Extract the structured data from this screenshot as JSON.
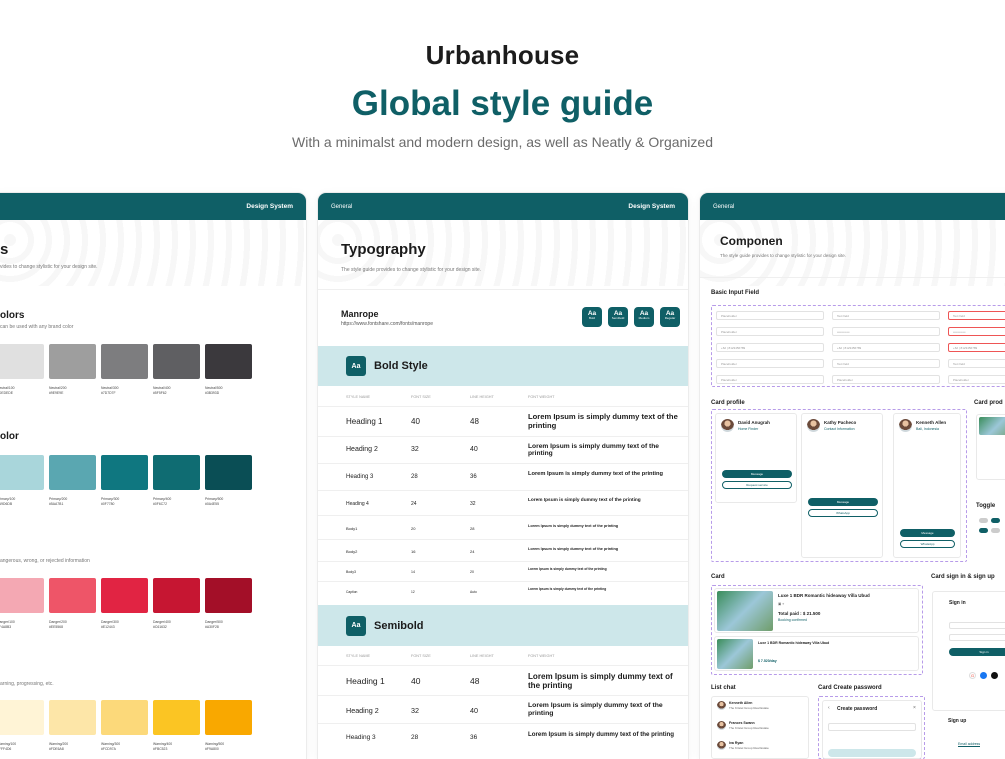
{
  "hero": {
    "brand": "Urbanhouse",
    "title": "Global style guide",
    "subtitle": "With a minimalst and modern design, as well as Neatly & Organized"
  },
  "colors": {
    "primary": "#0f5f66",
    "band": "#cde7ea"
  },
  "left_panel": {
    "bar_right": "Design System",
    "page_title": "s",
    "page_sub": "vides to change stylistic for your design site.",
    "neutral": {
      "title": "olors",
      "sub": "can be used with any brand color",
      "swatches": [
        {
          "color": "#e0e0e0",
          "name": "Neutral/100",
          "hex": "#DEDEDE"
        },
        {
          "color": "#9e9e9e",
          "name": "Neutral/200",
          "hex": "#9E9E9E"
        },
        {
          "color": "#7d7d7f",
          "name": "Neutral/300",
          "hex": "#7D7D7F"
        },
        {
          "color": "#5f5f62",
          "name": "Neutral/400",
          "hex": "#5F5F62"
        },
        {
          "color": "#3b393d",
          "name": "Neutral/500",
          "hex": "#3B393D"
        }
      ]
    },
    "primary": {
      "title": "olor",
      "swatches": [
        {
          "color": "#a9d6db",
          "name": "Primary/100",
          "hex": "#A9D6DB"
        },
        {
          "color": "#5aa7b1",
          "name": "Primary/200",
          "hex": "#5AA7B1"
        },
        {
          "color": "#0f7780",
          "name": "Primary/300",
          "hex": "#0F7780"
        },
        {
          "color": "#0f6c72",
          "name": "Primary/400",
          "hex": "#0F6C72"
        },
        {
          "color": "#0a4e55",
          "name": "Primary/500",
          "hex": "#0A4E55"
        }
      ]
    },
    "danger": {
      "sub": "angerous, wrong, or rejected information",
      "swatches": [
        {
          "color": "#f4a8b3",
          "name": "Danger/100",
          "hex": "#F4A8B3"
        },
        {
          "color": "#ee5568",
          "name": "Danger/200",
          "hex": "#EE5568"
        },
        {
          "color": "#e12443",
          "name": "Danger/300",
          "hex": "#E12443"
        },
        {
          "color": "#c61632",
          "name": "Danger/400",
          "hex": "#C61632"
        },
        {
          "color": "#a30f28",
          "name": "Danger/500",
          "hex": "#A30F28"
        }
      ]
    },
    "warning": {
      "sub": "arning, progressing, etc.",
      "swatches": [
        {
          "color": "#fff4d6",
          "name": "Warning/100",
          "hex": "#FFF4D6"
        },
        {
          "color": "#fde6a8",
          "name": "Warning/200",
          "hex": "#FDE6A8"
        },
        {
          "color": "#fcd97a",
          "name": "Warning/300",
          "hex": "#FCD97A"
        },
        {
          "color": "#fbc523",
          "name": "Warning/400",
          "hex": "#FBC523"
        },
        {
          "color": "#f9a800",
          "name": "Warning/500",
          "hex": "#F9A800"
        }
      ]
    }
  },
  "middle_panel": {
    "bar_left": "General",
    "bar_right": "Design System",
    "title": "Typography",
    "sub": "The style guide provides to change stylistic for your design site.",
    "font_name": "Manrope",
    "font_url": "https://www.fontshare.com/fonts/manrope",
    "weights": [
      {
        "aa": "Aa",
        "label": "Bold"
      },
      {
        "aa": "Aa",
        "label": "Semibold"
      },
      {
        "aa": "Aa",
        "label": "Medium"
      },
      {
        "aa": "Aa",
        "label": "Regular"
      }
    ],
    "columns": [
      "STYLE NAME",
      "FONT SIZE",
      "LINE HEIGHT",
      "FONT WEIGHT"
    ],
    "bold": {
      "label": "Bold Style",
      "rows": [
        {
          "name": "Heading 1",
          "size": "40",
          "lh": "48",
          "sample": "Lorem Ipsum is simply dummy text of the printing"
        },
        {
          "name": "Heading 2",
          "size": "32",
          "lh": "40",
          "sample": "Lorem Ipsum is simply dummy text of the printing"
        },
        {
          "name": "Heading 3",
          "size": "28",
          "lh": "36",
          "sample": "Lorem Ipsum is simply dummy text of the printing"
        },
        {
          "name": "Heading 4",
          "size": "24",
          "lh": "32",
          "sample": "Lorem Ipsum is simply dummy text of the printing"
        },
        {
          "name": "Body1",
          "size": "20",
          "lh": "28",
          "sample": "Lorem Ipsum is simply dummy text of the printing"
        },
        {
          "name": "Body2",
          "size": "16",
          "lh": "24",
          "sample": "Lorem Ipsum is simply dummy text of the printing"
        },
        {
          "name": "Body3",
          "size": "14",
          "lh": "20",
          "sample": "Lorem Ipsum is simply dummy text of the printing"
        },
        {
          "name": "Caption",
          "size": "12",
          "lh": "Auto",
          "sample": "Lorem Ipsum is simply dummy text of the printing"
        }
      ]
    },
    "semibold": {
      "label": "Semibold",
      "rows": [
        {
          "name": "Heading 1",
          "size": "40",
          "lh": "48",
          "sample": "Lorem Ipsum is simply dummy text of the printing"
        },
        {
          "name": "Heading 2",
          "size": "32",
          "lh": "40",
          "sample": "Lorem Ipsum is simply dummy text of the printing"
        },
        {
          "name": "Heading 3",
          "size": "28",
          "lh": "36",
          "sample": "Lorem Ipsum is simply dummy text of the printing"
        }
      ]
    }
  },
  "right_panel": {
    "bar_left": "General",
    "title": "Componen",
    "sub": "The style guide provides to change stylistic for your design site.",
    "basic_input": "Basic Input Field",
    "input_placeholders": [
      "Placeholder",
      "Text field",
      "Text field",
      "Placeholder",
      "••••••••••••",
      "••••••••••••",
      "+62 | 8123456789",
      "+62 | 8123456789",
      "+62 | 8123456789",
      "Placeholder",
      "Text field",
      "Text field",
      "Placeholder",
      "Placeholder",
      "Placeholder"
    ],
    "card_profile": "Card profile",
    "card_prod": "Card prod",
    "profiles": [
      {
        "name": "David Anugrah",
        "role": "Home Finder",
        "msg": "Message",
        "req": "Request service"
      },
      {
        "name": "Kathy Pacheco",
        "role": "Contact Information",
        "msg": "Message",
        "req": "WhatsApp"
      },
      {
        "name": "Kenneth Allen",
        "role": "Bali, Indonesia",
        "msg": "Message",
        "req": "WhatsApp"
      }
    ],
    "toggle": "Toggle",
    "card": "Card",
    "card_title_1": "Luxe 1 BDR Romantic hideaway Villa Ubud",
    "total_paid": "Total paid : $ 21.500",
    "booking": "Booking confirmed",
    "card_title_2": "Luxe 1 BDR Romantic hideaway Villa Ubud",
    "price": "$ 7.520/day",
    "card_sign": "Card sign in & sign up",
    "sign_in": "Sign in",
    "sign_in_btn": "Sign in",
    "sign_up": "Sign up",
    "email_address": "Email address",
    "list_chat": "List chat",
    "chats": [
      {
        "name": "Kenneth Allen",
        "sub": "The Kristel Group Real Estate"
      },
      {
        "name": "Frances Swann",
        "sub": "The Kristel Group Real Estate"
      },
      {
        "name": "Iva Ryan",
        "sub": "The Kristel Group Real Estate"
      }
    ],
    "card_create_password": "Card Create password",
    "create_password": "Create password"
  }
}
